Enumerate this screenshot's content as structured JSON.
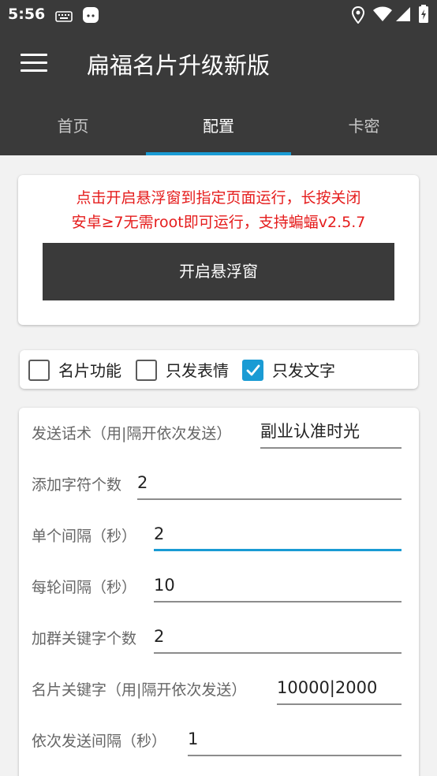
{
  "status": {
    "time": "5:56"
  },
  "appbar": {
    "title": "扁福名片升级新版"
  },
  "tabs": [
    {
      "label": "首页"
    },
    {
      "label": "配置"
    },
    {
      "label": "卡密"
    }
  ],
  "notice": {
    "line1": "点击开启悬浮窗到指定页面运行，长按关闭",
    "line2": "安卓≥7无需root即可运行，支持蝙蝠v2.5.7",
    "button": "开启悬浮窗"
  },
  "checkboxes": [
    {
      "label": "名片功能",
      "checked": false
    },
    {
      "label": "只发表情",
      "checked": false
    },
    {
      "label": "只发文字",
      "checked": true
    }
  ],
  "form": [
    {
      "label": "发送话术（用|隔开依次发送）",
      "value": "副业认准时光"
    },
    {
      "label": "添加字符个数",
      "value": "2"
    },
    {
      "label": "单个间隔（秒）",
      "value": "2"
    },
    {
      "label": "每轮间隔（秒）",
      "value": "10"
    },
    {
      "label": "加群关键字个数",
      "value": "2"
    },
    {
      "label": "名片关键字（用|隔开依次发送）",
      "value": "10000|2000"
    },
    {
      "label": "依次发送间隔（秒）",
      "value": "1"
    }
  ],
  "colors": {
    "accent": "#1a9bd4",
    "appbar": "#3a3a3a",
    "notice": "#e51c1c"
  }
}
